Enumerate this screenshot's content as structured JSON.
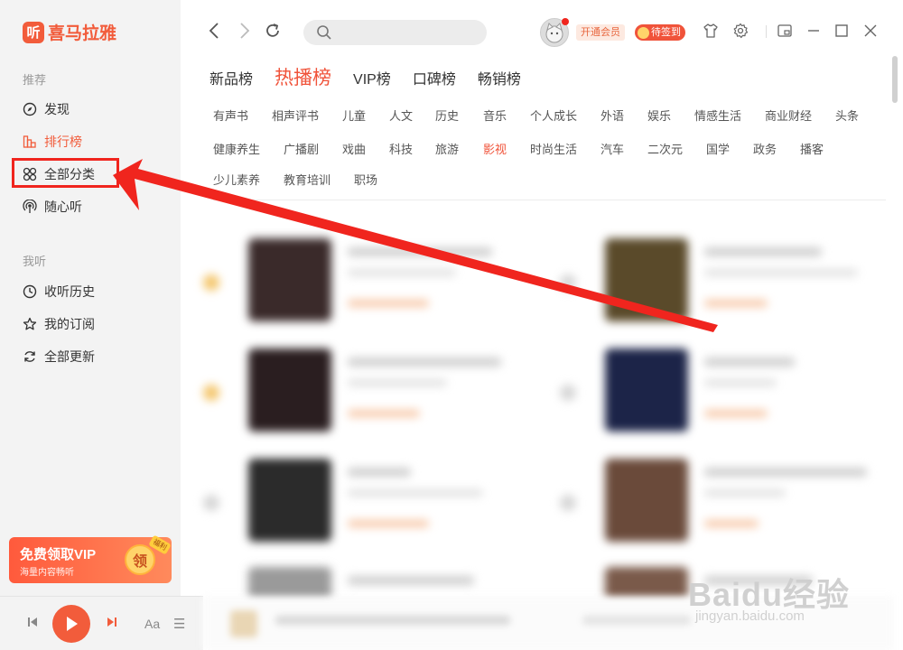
{
  "app": {
    "logo_text": "喜马拉雅",
    "logo_char": "听"
  },
  "sidebar": {
    "section_recommend": "推荐",
    "section_mine": "我听",
    "items_recommend": [
      {
        "label": "发现",
        "icon": "compass-icon"
      },
      {
        "label": "排行榜",
        "icon": "ranking-icon"
      },
      {
        "label": "全部分类",
        "icon": "grid-icon"
      },
      {
        "label": "随心听",
        "icon": "radio-icon"
      }
    ],
    "items_mine": [
      {
        "label": "收听历史",
        "icon": "clock-icon"
      },
      {
        "label": "我的订阅",
        "icon": "star-icon"
      },
      {
        "label": "全部更新",
        "icon": "refresh-icon"
      }
    ],
    "vip_banner": {
      "title": "免费领取VIP",
      "subtitle": "海量内容畅听",
      "coin_label": "领",
      "tag": "福利"
    }
  },
  "player": {
    "aa_label": "Aa",
    "list_label": "☰"
  },
  "topbar": {
    "search_placeholder": "",
    "vip_button": "开通会员",
    "checkin_button": "待签到"
  },
  "tabs": [
    {
      "label": "新品榜",
      "active": false
    },
    {
      "label": "热播榜",
      "active": true
    },
    {
      "label": "VIP榜",
      "active": false
    },
    {
      "label": "口碑榜",
      "active": false
    },
    {
      "label": "畅销榜",
      "active": false
    }
  ],
  "categories": {
    "row1": [
      "有声书",
      "相声评书",
      "儿童",
      "人文",
      "历史",
      "音乐",
      "个人成长",
      "外语",
      "娱乐",
      "情感生活",
      "商业财经",
      "头条"
    ],
    "row2": [
      "健康养生",
      "广播剧",
      "戏曲",
      "科技",
      "旅游",
      "影视",
      "时尚生活",
      "汽车",
      "二次元",
      "国学",
      "政务",
      "播客"
    ],
    "row3": [
      "少儿素养",
      "教育培训",
      "职场"
    ],
    "active": "影视"
  },
  "watermark": {
    "main": "Baidu经验",
    "sub": "jingyan.baidu.com"
  },
  "colors": {
    "accent": "#f25c3b",
    "highlight": "#f0251e"
  }
}
